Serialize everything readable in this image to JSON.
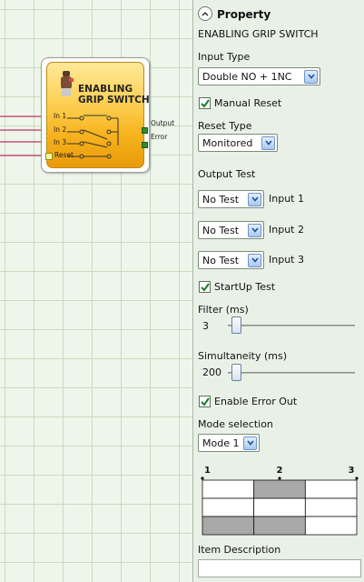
{
  "canvas": {
    "block": {
      "title_line1": "ENABLING",
      "title_line2": "GRIP SWITCH",
      "inputs": [
        "In 1",
        "In 2",
        "In 3",
        "Reset"
      ],
      "outputs": [
        "Output",
        "Error"
      ],
      "colors": {
        "body": "#f6b21c",
        "output_led": "#2f8d2f",
        "wire": "#c0336a"
      }
    }
  },
  "panel": {
    "header": {
      "title": "Property",
      "subtitle": "ENABLING GRIP SWITCH"
    },
    "input_type": {
      "label": "Input Type",
      "value": "Double NO + 1NC"
    },
    "manual_reset": {
      "label": "Manual Reset",
      "checked": true
    },
    "reset_type": {
      "label": "Reset Type",
      "value": "Monitored"
    },
    "output_test": {
      "label": "Output Test",
      "rows": [
        {
          "value": "No Test",
          "input_label": "Input 1"
        },
        {
          "value": "No Test",
          "input_label": "Input 2"
        },
        {
          "value": "No Test",
          "input_label": "Input 3"
        }
      ]
    },
    "startup_test": {
      "label": "StartUp Test",
      "checked": true
    },
    "filter": {
      "label": "Filter (ms)",
      "value": "3"
    },
    "simultaneity": {
      "label": "Simultaneity (ms)",
      "value": "200"
    },
    "enable_error_out": {
      "label": "Enable Error Out",
      "checked": true
    },
    "mode_selection": {
      "label": "Mode selection",
      "value": "Mode 1",
      "diagram": {
        "positions": [
          "1",
          "2",
          "3"
        ],
        "active_cells": [
          [
            0,
            1,
            0
          ],
          [
            0,
            0,
            0
          ],
          [
            1,
            1,
            0
          ]
        ]
      }
    },
    "item_description": {
      "label": "Item Description",
      "value": ""
    }
  },
  "colors": {
    "panel_bg": "#e9f1e7",
    "canvas_bg": "#eef5ea",
    "cell_active": "#a9a9a9",
    "dropdown_accent": "#6f93c9"
  }
}
